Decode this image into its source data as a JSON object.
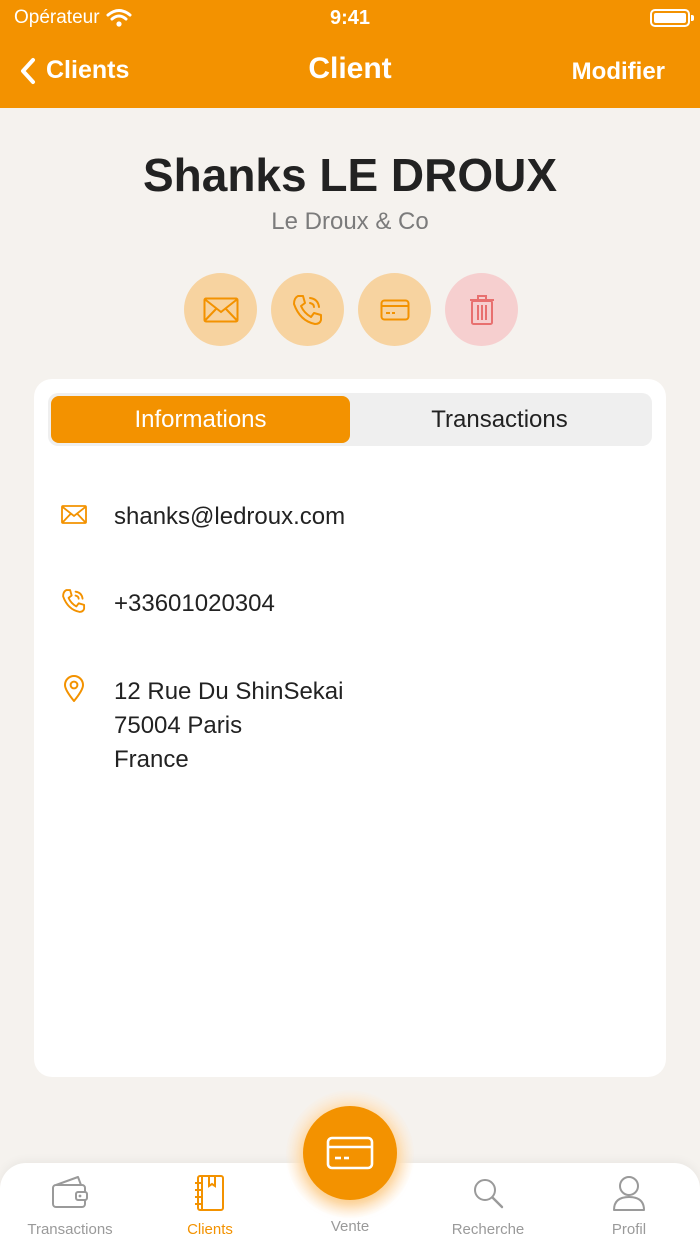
{
  "status_bar": {
    "carrier": "Opérateur",
    "time": "9:41"
  },
  "nav": {
    "back_label": "Clients",
    "title": "Client",
    "edit_label": "Modifier"
  },
  "client": {
    "name": "Shanks LE DROUX",
    "company": "Le Droux & Co"
  },
  "actions": [
    {
      "icon": "envelope-icon"
    },
    {
      "icon": "phone-icon"
    },
    {
      "icon": "card-icon"
    },
    {
      "icon": "trash-icon"
    }
  ],
  "tabs_segment": {
    "informations": "Informations",
    "transactions": "Transactions",
    "selected": "Informations"
  },
  "info": {
    "email": "shanks@ledroux.com",
    "phone": "+33601020304",
    "address_line1": "12 Rue Du ShinSekai",
    "address_line2": "75004 Paris",
    "address_line3": "France"
  },
  "tabbar": {
    "transactions": "Transactions",
    "clients": "Clients",
    "vente": "Vente",
    "recherche": "Recherche",
    "profil": "Profil",
    "active": "Clients"
  },
  "colors": {
    "accent": "#f39200",
    "accent_light": "#f7d3a0",
    "danger_light": "#f6cfcf",
    "danger": "#e8706f"
  }
}
